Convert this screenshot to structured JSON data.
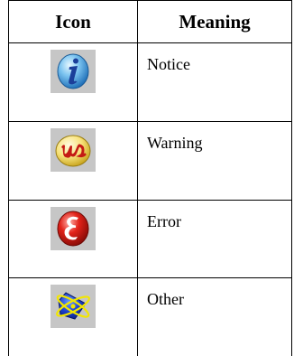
{
  "table": {
    "headers": {
      "icon": "Icon",
      "meaning": "Meaning"
    },
    "rows": [
      {
        "icon": "info-icon",
        "meaning": "Notice"
      },
      {
        "icon": "warning-icon",
        "meaning": "Warning"
      },
      {
        "icon": "error-icon",
        "meaning": "Error"
      },
      {
        "icon": "other-atom-icon",
        "meaning": "Other"
      }
    ]
  }
}
